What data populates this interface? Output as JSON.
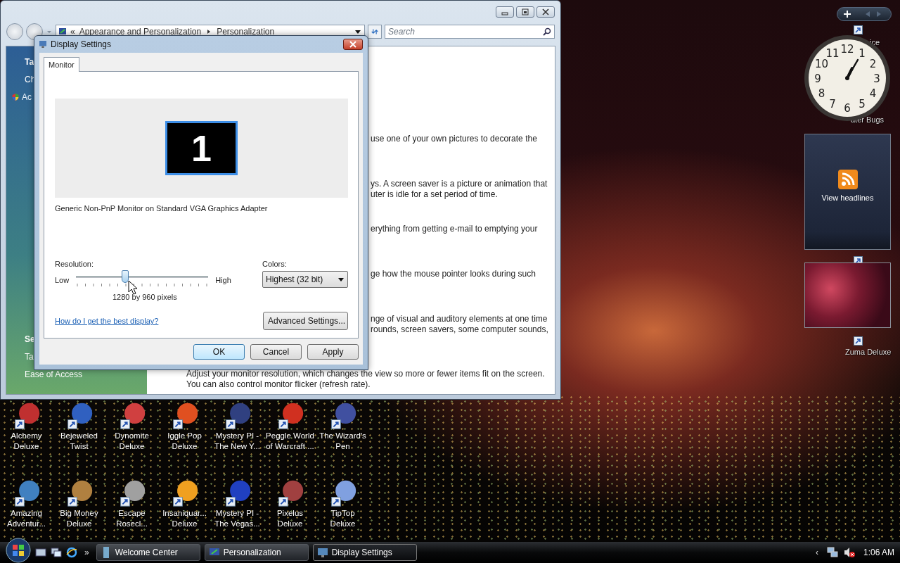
{
  "explorer_window": {
    "address": {
      "prefix": "«",
      "path": [
        "Appearance and Personalization",
        "Personalization"
      ]
    },
    "search": {
      "placeholder": "Search"
    },
    "nav_top": [
      {
        "text": "Ta",
        "kind": "heading"
      },
      {
        "text": "Ch",
        "kind": "link"
      },
      {
        "text": "Ac",
        "kind": "shield"
      }
    ],
    "nav_bottom": [
      {
        "text": "Se",
        "kind": "heading"
      },
      {
        "text": "Ta",
        "kind": "link"
      },
      {
        "text": "Ease of Access",
        "kind": "link"
      }
    ],
    "content": [
      {
        "kind": "partial",
        "lines": [
          "use one of your own pictures to decorate the"
        ]
      },
      {
        "kind": "partial",
        "lines": [
          "ys. A screen saver is a picture or animation that",
          "uter is idle for a set period of time."
        ]
      },
      {
        "kind": "partial",
        "lines": [
          "erything from getting e-mail to emptying your"
        ]
      },
      {
        "kind": "partial",
        "lines": [
          "ge how the mouse pointer looks during such"
        ]
      },
      {
        "kind": "partial",
        "lines": [
          "nge of visual and auditory elements at one time",
          "rounds, screen savers, some computer sounds,"
        ]
      },
      {
        "kind": "full",
        "lines": [
          "Adjust your monitor resolution, which changes the view so more or fewer items fit on the screen.",
          "You can also control monitor flicker (refresh rate)."
        ]
      }
    ]
  },
  "dialog": {
    "title": "Display Settings",
    "tabs": [
      {
        "label": "Monitor",
        "selected": true
      }
    ],
    "monitor": {
      "number": "1",
      "selected": true
    },
    "adapter": "Generic Non-PnP Monitor on Standard VGA Graphics Adapter",
    "resolution": {
      "label": "Resolution:",
      "low": "Low",
      "high": "High",
      "level": 0.37,
      "reading": "1280 by 960 pixels"
    },
    "colors": {
      "label": "Colors:",
      "value": "Highest (32 bit)"
    },
    "help_link": "How do I get the best display?",
    "advanced_button": "Advanced Settings...",
    "buttons": [
      {
        "label": "OK",
        "default": true
      },
      {
        "label": "Cancel",
        "default": false
      },
      {
        "label": "Apply",
        "default": false
      }
    ]
  },
  "gadgets": {
    "clock": {
      "numeral_rows": [
        [
          "11",
          "12",
          "1"
        ],
        [
          "10",
          "2"
        ],
        [
          "9",
          "3"
        ],
        [
          "8",
          "4"
        ],
        [
          "7",
          "6",
          "5"
        ]
      ]
    },
    "feed": {
      "label": "View headlines"
    }
  },
  "desktop_icons": [
    {
      "lines": [
        "Alchemy",
        "Deluxe"
      ]
    },
    {
      "lines": [
        "Bejeweled",
        "Twist"
      ]
    },
    {
      "lines": [
        "Dynomite",
        "Deluxe"
      ]
    },
    {
      "lines": [
        "Iggle Pop",
        "Deluxe"
      ]
    },
    {
      "lines": [
        "Mystery PI -",
        "The New Y..."
      ]
    },
    {
      "lines": [
        "Peggle World",
        "of Warcraft ..."
      ]
    },
    {
      "lines": [
        "The Wizard's",
        "Pen"
      ]
    },
    {
      "lines": [
        "Amazing",
        "Adventur..."
      ]
    },
    {
      "lines": [
        "Big Money",
        "Deluxe"
      ]
    },
    {
      "lines": [
        "Escape",
        "Rosecl..."
      ]
    },
    {
      "lines": [
        "Insaniquar...",
        "Deluxe"
      ]
    },
    {
      "lines": [
        "Mystery PI -",
        "The Vegas..."
      ]
    },
    {
      "lines": [
        "Pixelus",
        "Deluxe"
      ]
    },
    {
      "lines": [
        "TipTop",
        "Deluxe"
      ]
    }
  ],
  "hidden_icons": [
    "ice",
    "ater Bugs",
    "Zuma Deluxe"
  ],
  "taskbar": {
    "overflow": "»",
    "tasks": [
      {
        "label": "Welcome Center",
        "selected": false
      },
      {
        "label": "Personalization",
        "selected": false
      },
      {
        "label": "Display Settings",
        "selected": true
      }
    ],
    "tray_toggle": "‹",
    "time": "1:06 AM"
  }
}
